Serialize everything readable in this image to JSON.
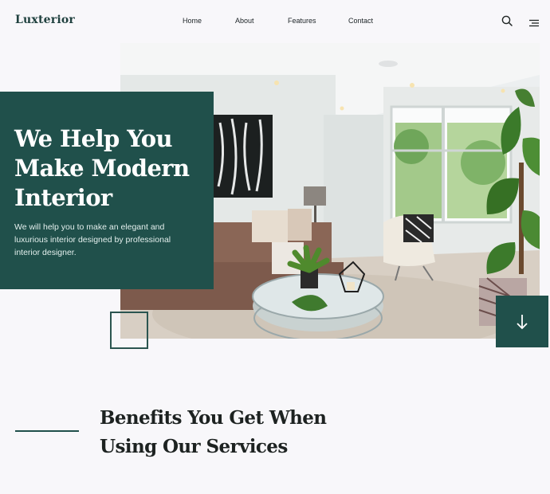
{
  "header": {
    "logo": "Luxterior",
    "nav": [
      {
        "label": "Home"
      },
      {
        "label": "About"
      },
      {
        "label": "Features"
      },
      {
        "label": "Contact"
      }
    ],
    "icons": {
      "search": "search-icon",
      "menu": "menu-icon"
    }
  },
  "hero": {
    "title_lines": [
      "We Help You",
      "Make Modern",
      "Interior"
    ],
    "subtitle": "We will help you to make an elegant and luxurious interior designed by professional interior designer.",
    "image": "living-room-photo",
    "scroll_icon": "arrow-down-icon"
  },
  "benefits": {
    "title_lines": [
      "Benefits You Get When",
      "Using Our Services"
    ]
  },
  "colors": {
    "accent": "#20504b",
    "background": "#f8f7fa",
    "text": "#1d2221"
  }
}
